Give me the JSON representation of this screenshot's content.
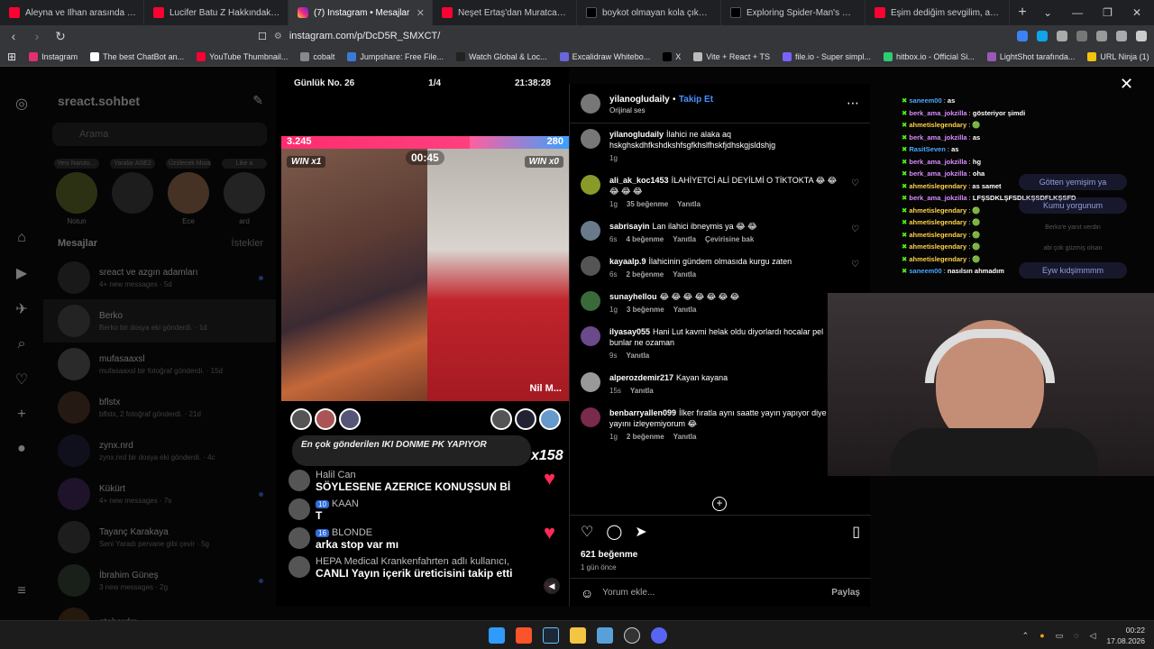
{
  "browser": {
    "tabs": [
      {
        "label": "Aleyna ve İlhan arasında tansiyon y...",
        "icon": "yt"
      },
      {
        "label": "Lucifer Batu Z Hakkındaki Tüm G...",
        "icon": "yt"
      },
      {
        "label": "(7) Instagram • Mesajlar",
        "icon": "ig",
        "active": true
      },
      {
        "label": "Neşet Ertaş'dan Muratcaz'a Cevap G...",
        "icon": "yt"
      },
      {
        "label": "boykot olmayan kola çıkmış hemen...",
        "icon": "tt"
      },
      {
        "label": "Exploring Spider-Man's Universe | T...",
        "icon": "tt"
      },
      {
        "label": "Eşim dediğim sevgilim, annem ile k...",
        "icon": "yt"
      }
    ],
    "url": "instagram.com/p/DcD5R_SMXCT/",
    "bookmarks": [
      {
        "label": "Instagram",
        "color": "#e1306c"
      },
      {
        "label": "The best ChatBot an...",
        "color": "#ffffff"
      },
      {
        "label": "YouTube Thumbnail...",
        "color": "#ff0033"
      },
      {
        "label": "cobalt",
        "color": "#888888"
      },
      {
        "label": "Jumpshare: Free File...",
        "color": "#3a7bd5"
      },
      {
        "label": "Watch Global & Loc...",
        "color": "#222222"
      },
      {
        "label": "Excalidraw Whitebo...",
        "color": "#6965db"
      },
      {
        "label": "X",
        "color": "#000000"
      },
      {
        "label": "Vite + React + TS",
        "color": "#bbbbbb"
      },
      {
        "label": "file.io - Super simpl...",
        "color": "#7b61ff"
      },
      {
        "label": "hitbox.io - Official Si...",
        "color": "#2ecc71"
      },
      {
        "label": "LightShot tarafında...",
        "color": "#9b59b6"
      },
      {
        "label": "URL Ninja (1)",
        "color": "#f1c40f"
      }
    ]
  },
  "sidebar": {
    "username": "sreact.sohbet",
    "search_placeholder": "Arama",
    "notes": [
      {
        "note": "Yeni Naruto…",
        "name": "Notun"
      },
      {
        "note": "Yaralar ASE2",
        "name": ""
      },
      {
        "note": "Üzülecek Murat Bil",
        "name": "Ece"
      },
      {
        "note": "Like a",
        "name": "ard"
      }
    ],
    "section_title": "Mesajlar",
    "section_right": "İstekler",
    "conversations": [
      {
        "name": "sreact ve azgın adamları",
        "sub": "4+ new messages · 5d"
      },
      {
        "name": "Berko",
        "sub": "Berko bir dosya eki gönderdi. · 1d"
      },
      {
        "name": "mufasaaxsl",
        "sub": "mufasaaxsl bir fotoğraf gönderdi. · 15d"
      },
      {
        "name": "bflstx",
        "sub": "bflstx, 2 fotoğraf gönderdi. · 21d"
      },
      {
        "name": "zynx.nrd",
        "sub": "zynx.nrd bir dosya eki gönderdi. · 4c"
      },
      {
        "name": "Kükürt",
        "sub": "4+ new messages · 7s"
      },
      {
        "name": "Tayanç Karakaya",
        "sub": "Seni Yaradı pervane gibi çevir · 5g"
      },
      {
        "name": "İbrahim Güneş",
        "sub": "3 new messages · 2g"
      },
      {
        "name": "gtahardrp",
        "sub": ""
      }
    ]
  },
  "video": {
    "stats": [
      "Günlük No. 26",
      "1/4",
      "21:38:28"
    ],
    "score_left": "3.245",
    "score_right": "280",
    "timer": "00:45",
    "win_left": "WIN x1",
    "win_right": "WIN x0",
    "right_host": "Nil M...",
    "gift_banner": "En çok gönderilen  IKI DONME PK YAPIYOR",
    "gift_count": "x158",
    "chat": [
      {
        "who": "Halil Can",
        "text": "SÖYLESENE AZERICE KONUŞSUN Bİ",
        "badge": ""
      },
      {
        "who": "KAAN",
        "text": "T",
        "badge": "10"
      },
      {
        "who": "BLONDE",
        "text": "arka stop var mı",
        "badge": "16"
      },
      {
        "who": "HEPA Medical Krankenfahrten adlı kullanıcı,",
        "text": "CANLI Yayın içerik üreticisini takip etti",
        "badge": ""
      }
    ]
  },
  "post": {
    "author": "yilanogludaily",
    "follow_label": "Takip Et",
    "sound": "Orijinal ses",
    "comments": [
      {
        "user": "yilanogludaily",
        "text": "İlahici ne alaka aq hskghskdhfkshdkshfsgfkhslfhskfjdhskgjsldshjg",
        "time": "1g",
        "likes": "",
        "reply": "",
        "extra": ""
      },
      {
        "user": "ali_ak_koc1453",
        "text": "İLAHİYETCİ ALİ DEYİLMİ O TİKTOKTA 😂 😂 😂 😂 😂",
        "time": "1g",
        "likes": "35 beğenme",
        "reply": "Yanıtla",
        "extra": ""
      },
      {
        "user": "sabrisayin",
        "text": "Lan ilahici ibneymis ya 😂 😂",
        "time": "6s",
        "likes": "4 beğenme",
        "reply": "Yanıtla",
        "extra": "Çevirisine bak"
      },
      {
        "user": "kayaalp.9",
        "text": "İlahicinin gündem olmasıda kurgu zaten",
        "time": "6s",
        "likes": "2 beğenme",
        "reply": "Yanıtla",
        "extra": ""
      },
      {
        "user": "sunayhellou",
        "text": "😂 😂 😂 😂 😂 😂 😂",
        "time": "1g",
        "likes": "3 beğenme",
        "reply": "Yanıtla",
        "extra": ""
      },
      {
        "user": "ilyasay055",
        "text": "Hani Lut kavmi helak oldu diyorlardı hocalar pel bunlar ne ozaman",
        "time": "9s",
        "likes": "",
        "reply": "Yanıtla",
        "extra": ""
      },
      {
        "user": "alperozdemir217",
        "text": "Kayan kayana",
        "time": "15s",
        "likes": "",
        "reply": "Yanıtla",
        "extra": ""
      },
      {
        "user": "benbarryallen099",
        "text": "İlker fıratla aynı saatte yayın yapıyor diye yayını izleyemiyorum 😂",
        "time": "1g",
        "likes": "2 beğenme",
        "reply": "Yanıtla",
        "extra": ""
      }
    ],
    "like_count": "621 beğenme",
    "posted_ago": "1 gün önce",
    "comment_placeholder": "Yorum ekle...",
    "post_label": "Paylaş"
  },
  "stream_chat": [
    {
      "name": "saneem00",
      "msg": "as",
      "color": "#4aa8ff"
    },
    {
      "name": "berk_ama_jokzilla",
      "msg": "gösteriyor şimdi",
      "color": "#d98cff"
    },
    {
      "name": "ahmetislegendary",
      "msg": "🟢",
      "color": "#ffd24a"
    },
    {
      "name": "berk_ama_jokzilla",
      "msg": "as",
      "color": "#d98cff"
    },
    {
      "name": "RasitSeven",
      "msg": "as",
      "color": "#4aa8ff"
    },
    {
      "name": "berk_ama_jokzilla",
      "msg": "hg",
      "color": "#d98cff"
    },
    {
      "name": "berk_ama_jokzilla",
      "msg": "oha",
      "color": "#d98cff"
    },
    {
      "name": "ahmetislegendary",
      "msg": "as samet",
      "color": "#ffd24a"
    },
    {
      "name": "berk_ama_jokzilla",
      "msg": "LFŞSDKLŞFSDLKŞSDFLKŞSFD",
      "color": "#d98cff"
    },
    {
      "name": "ahmetislegendary",
      "msg": "🟢",
      "color": "#ffd24a"
    },
    {
      "name": "ahmetislegendary",
      "msg": "🟢",
      "color": "#ffd24a"
    },
    {
      "name": "ahmetislegendary",
      "msg": "🟢",
      "color": "#ffd24a"
    },
    {
      "name": "ahmetislegendary",
      "msg": "🟢",
      "color": "#ffd24a"
    },
    {
      "name": "ahmetislegendary",
      "msg": "🟢",
      "color": "#ffd24a"
    },
    {
      "name": "saneem00",
      "msg": "nasılsın ahmadım",
      "color": "#4aa8ff"
    }
  ],
  "bubbles": [
    "Götten yemişim ya",
    "Kumu yorgunum",
    "Berko'e yanıt verdin",
    "abi çok güzmiş olsan",
    "Eyw kıdşimmmm"
  ],
  "taskbar": {
    "time": "00:22",
    "date": "17.08.2026"
  }
}
